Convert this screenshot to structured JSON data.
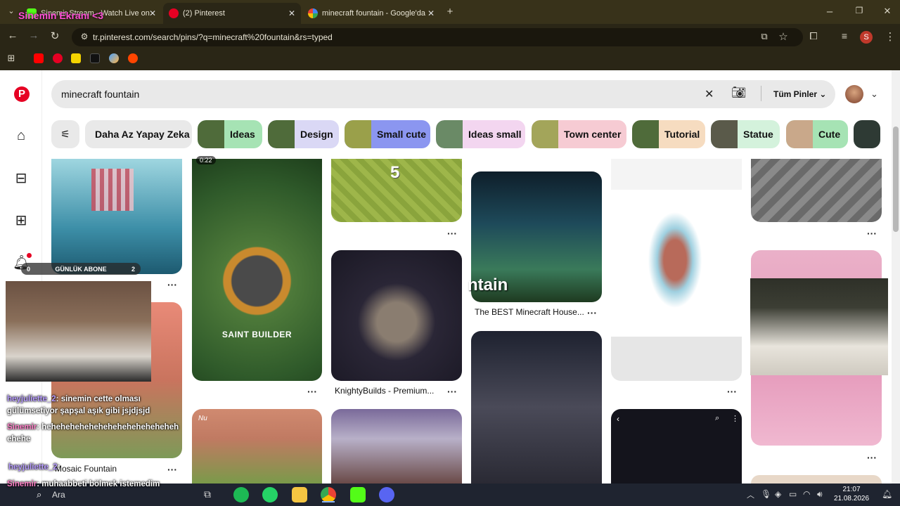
{
  "browser": {
    "tabs": [
      {
        "label": "Sinemir Stream - Watch Live on",
        "active": false
      },
      {
        "label": "(2) Pinterest",
        "active": true
      },
      {
        "label": "minecraft fountain - Google'da",
        "active": false
      }
    ],
    "new_tab_label": "+",
    "url": "tr.pinterest.com/search/pins/?q=minecraft%20fountain&rs=typed",
    "overlay_title": "Sinemin Ekranı <3",
    "profile_initial": "S"
  },
  "pinterest": {
    "search_value": "minecraft fountain",
    "filter_label": "Tüm Pinler",
    "chips": [
      "Daha Az Yapay Zeka",
      "Ideas",
      "Design",
      "Small cute",
      "Ideas small",
      "Town center",
      "Tutorial",
      "Statue",
      "Cute"
    ],
    "pins": {
      "p1_badge_label": "GÜNLÜK ABONE",
      "p1_badge_left": "0",
      "p1_badge_right": "2",
      "p2_duration": "0:22",
      "p2_overlay": "SAINT BUILDER",
      "p3_number": "5",
      "p4_overlay": "ntain",
      "p4_caption": "The BEST Minecraft House...",
      "p5_caption": "KnightyBuilds - Premium...",
      "p6_caption": "Mosaic Fountain",
      "p7_signature": "Nu"
    }
  },
  "chat": [
    {
      "user": "heyjuliette_2",
      "text": ": sinemin cette olması gülümsetiyor şapşal aşık gibi jsjdjsjd"
    },
    {
      "user": "Sinemir",
      "text": ": hehehehehehehehehehehehehehehehehe"
    },
    {
      "user": "heyjuliette_2",
      "text": ":"
    },
    {
      "user": "Sinemir",
      "text": ": muhaabbeti bölmek istemedim"
    }
  ],
  "taskbar": {
    "search_placeholder": "Ara",
    "time": "21:07",
    "date": "21.08.2026"
  }
}
